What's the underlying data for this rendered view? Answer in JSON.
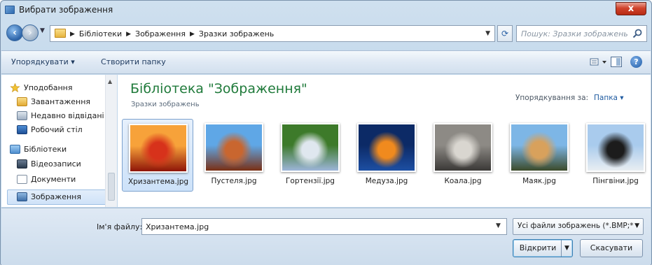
{
  "window": {
    "title": "Вибрати зображення",
    "close_label": "x"
  },
  "address": {
    "crumbs": [
      "Бібліотеки",
      "Зображення",
      "Зразки зображень"
    ],
    "search_placeholder": "Пошук: Зразки зображень"
  },
  "toolbar": {
    "organize_label": "Упорядкувати ▾",
    "new_folder_label": "Створити папку",
    "help_label": "?"
  },
  "nav": {
    "items": [
      {
        "label": "Уподобання",
        "icon": "star-icon"
      },
      {
        "label": "Завантаження",
        "icon": "downloads-folder-icon"
      },
      {
        "label": "Недавно відвідані",
        "icon": "recent-places-icon"
      },
      {
        "label": "Робочий стіл",
        "icon": "desktop-icon"
      },
      {
        "label": "Бібліотеки",
        "icon": "libraries-icon"
      },
      {
        "label": "Відеозаписи",
        "icon": "videos-icon"
      },
      {
        "label": "Документи",
        "icon": "documents-icon"
      },
      {
        "label": "Зображення",
        "icon": "pictures-icon"
      }
    ],
    "selected": "Зображення"
  },
  "content": {
    "title": "Бібліотека \"Зображення\"",
    "subtitle": "Зразки зображень",
    "arrange_label": "Упорядкування за:",
    "arrange_value": "Папка ▾",
    "files": [
      {
        "name": "Хризантема.jpg",
        "selected": true,
        "colors": [
          "#f7a23a",
          "#d7321b",
          "#8e1408"
        ]
      },
      {
        "name": "Пустеля.jpg",
        "selected": false,
        "colors": [
          "#5fa7e6",
          "#c9662f",
          "#7a2f14"
        ]
      },
      {
        "name": "Гортензії.jpg",
        "selected": false,
        "colors": [
          "#3d7a2a",
          "#dfe7ef",
          "#9db5d9"
        ]
      },
      {
        "name": "Медуза.jpg",
        "selected": false,
        "colors": [
          "#0c2a66",
          "#f08a1e",
          "#1d4fa3"
        ]
      },
      {
        "name": "Коала.jpg",
        "selected": false,
        "colors": [
          "#8d8a85",
          "#d9d6d0",
          "#3a3836"
        ]
      },
      {
        "name": "Маяк.jpg",
        "selected": false,
        "colors": [
          "#7db6e6",
          "#d8a15c",
          "#3b4a2a"
        ]
      },
      {
        "name": "Пінгвіни.jpg",
        "selected": false,
        "colors": [
          "#a9cbed",
          "#1c1c1c",
          "#e9eef2"
        ]
      }
    ]
  },
  "bottom": {
    "filename_label": "Ім'я файлу:",
    "filename_value": "Хризантема.jpg",
    "filter_value": "Усі файли зображень (*.BMP;*",
    "open_label": "Відкрити",
    "cancel_label": "Скасувати"
  }
}
